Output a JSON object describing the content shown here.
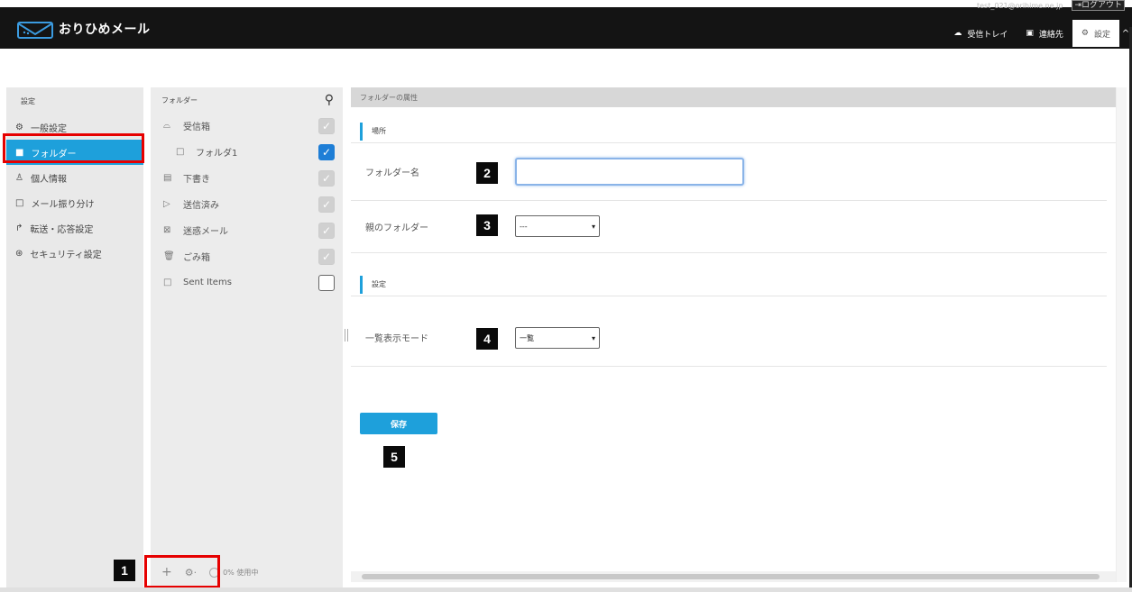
{
  "app": {
    "name": "おりひめメール"
  },
  "header": {
    "user_email": "test_021@orihime.ne.jp",
    "logout_label": "ログアウト",
    "nav": [
      {
        "label": "受信トレイ",
        "icon": "inbox-icon"
      },
      {
        "label": "連絡先",
        "icon": "contacts-icon"
      },
      {
        "label": "設定",
        "icon": "gear-icon"
      }
    ],
    "collapse": "^"
  },
  "settings": {
    "title": "設定",
    "items": [
      {
        "label": "一般設定",
        "icon": "gear-icon"
      },
      {
        "label": "フォルダー",
        "icon": "folder-icon"
      },
      {
        "label": "個人情報",
        "icon": "person-icon"
      },
      {
        "label": "メール振り分け",
        "icon": "folder-outline-icon"
      },
      {
        "label": "転送・応答設定",
        "icon": "forward-icon"
      },
      {
        "label": "セキュリティ設定",
        "icon": "security-icon"
      }
    ]
  },
  "folders": {
    "title": "フォルダー",
    "items": [
      {
        "label": "受信箱",
        "checked": true,
        "disabled": true
      },
      {
        "label": "フォルダ1",
        "checked": true,
        "disabled": false
      },
      {
        "label": "下書き",
        "checked": true,
        "disabled": true
      },
      {
        "label": "送信済み",
        "checked": true,
        "disabled": true
      },
      {
        "label": "迷惑メール",
        "checked": true,
        "disabled": true
      },
      {
        "label": "ごみ箱",
        "checked": true,
        "disabled": true
      },
      {
        "label": "Sent Items",
        "checked": false,
        "disabled": false
      }
    ],
    "footer": {
      "add": "+",
      "settings": "⚙·",
      "usage": "0% 使用中"
    }
  },
  "main": {
    "title": "フォルダーの属性",
    "section1": "場所",
    "folder_name_label": "フォルダー名",
    "folder_name_value": "",
    "parent_label": "親のフォルダー",
    "parent_value": "---",
    "section2": "設定",
    "view_mode_label": "一覧表示モード",
    "view_mode_value": "一覧",
    "save_label": "保存"
  },
  "badges": [
    "1",
    "2",
    "3",
    "4",
    "5"
  ],
  "colors": {
    "accent": "#1ea0db",
    "highlight": "#e60000",
    "header_bg": "#141414"
  }
}
